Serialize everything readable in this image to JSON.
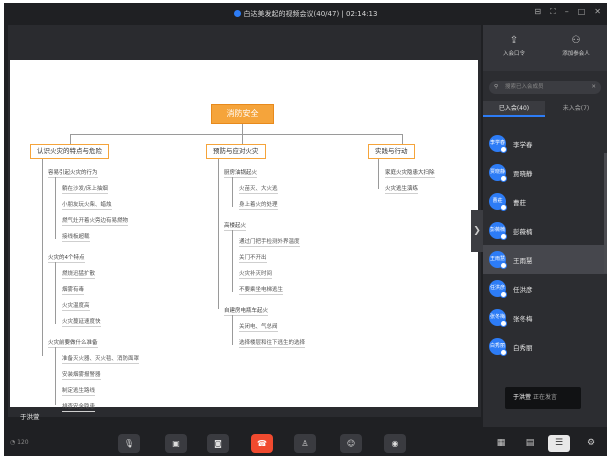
{
  "titlebar": {
    "title": "白达美发起的视频会议(40/47) | 02:14:13",
    "controls": [
      "⊟",
      "⛶",
      "–",
      "□",
      "✕"
    ]
  },
  "mindmap": {
    "root": "消防安全",
    "branches": [
      {
        "label": "认识火灾的特点与危险"
      },
      {
        "label": "预防与应对火灾"
      },
      {
        "label": "实践与行动"
      }
    ],
    "nodes": {
      "b1_n1": "容易引起火灾的行为",
      "b1_n1_c1": "躺在沙发/床上抽烟",
      "b1_n1_c2": "小朋友玩火柴、蜡烛",
      "b1_n1_c3": "燃气灶开着火旁边有易燃物",
      "b1_n1_c4": "接线板超载",
      "b1_n2": "火灾的4个特点",
      "b1_n2_c1": "燃烧迅猛扩散",
      "b1_n2_c2": "烟雾有毒",
      "b1_n2_c3": "火灾温度高",
      "b1_n2_c4": "火灾蔓延速度快",
      "b1_n3": "火灾前要做什么准备",
      "b1_n3_c1": "准备灭火器、灭火毯、消防面罩",
      "b1_n3_c2": "安装烟雾报警器",
      "b1_n3_c3": "制定逃生路线",
      "b1_n3_c4": "排查安全隐患",
      "b2_n1": "厨房油锅起火",
      "b2_n1_c1": "火苗灭、大火逃",
      "b2_n1_c2": "身上着火的处理",
      "b2_n2": "高楼起火",
      "b2_n2_c1": "通过门把手检测外界温度",
      "b2_n2_c2": "关门不开出",
      "b2_n2_c3": "火灾补灭时间",
      "b2_n2_c4": "不要乘坐电梯逃生",
      "b2_n3": "自建房电瓶车起火",
      "b2_n3_c1": "关闭电、气总阀",
      "b2_n3_c2": "选择楼层和往下逃生的选择",
      "b3_n1": "家庭火灾隐患大扫除",
      "b3_n2": "火灾逃生演练"
    }
  },
  "speaker_label": "于洪萱",
  "sidearrow": "❯",
  "sidebar": {
    "actions": [
      {
        "icon": "⇪",
        "label": "入会口令"
      },
      {
        "icon": "⚇",
        "label": "添加参会人"
      }
    ],
    "search_icon": "⚲",
    "search_placeholder": "搜索已入会成员",
    "search_clear": "✕",
    "tabs": [
      "已入会(40)",
      "未入会(7)"
    ],
    "participants": [
      {
        "avatar": "李学春",
        "name": "李学春"
      },
      {
        "avatar": "贾晓静",
        "name": "贾晓静"
      },
      {
        "avatar": "曹莊",
        "name": "曹莊"
      },
      {
        "avatar": "彭薇楠",
        "name": "彭薇楠"
      },
      {
        "avatar": "王雨慧",
        "name": "王雨慧"
      },
      {
        "avatar": "任洪彦",
        "name": "任洪彦"
      },
      {
        "avatar": "张冬梅",
        "name": "张冬梅"
      },
      {
        "avatar": "白秀丽",
        "name": "白秀丽"
      }
    ]
  },
  "tooltip": {
    "name": "于洪萱",
    "status": "正在发言"
  },
  "bottombar": {
    "signal": "◔ 120",
    "buttons": [
      "🎙",
      "▣",
      "◙",
      "☎",
      "♙",
      "☺",
      "◉"
    ],
    "right_buttons": [
      "▦",
      "▤",
      "☰",
      "⚙"
    ]
  }
}
